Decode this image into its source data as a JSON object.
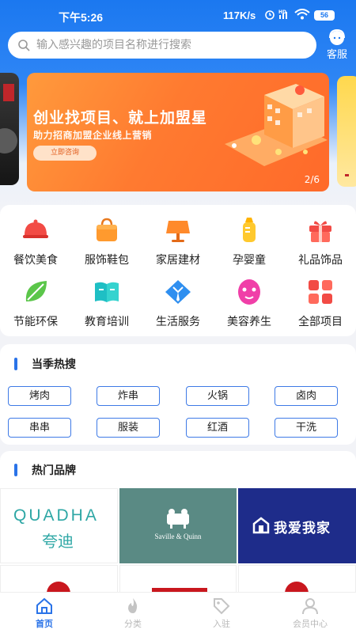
{
  "status": {
    "time": "下午5:26",
    "speed": "117K/s",
    "battery": "56"
  },
  "search": {
    "placeholder": "输入感兴趣的项目名称进行搜索",
    "service_label": "客服"
  },
  "banner": {
    "title": "创业找项目、就上加盟星",
    "subtitle": "助力招商加盟企业线上营销",
    "button": "立即咨询",
    "page": "2/6"
  },
  "categories": [
    {
      "label": "餐饮美食",
      "icon": "food-cloche-icon"
    },
    {
      "label": "服饰鞋包",
      "icon": "shopping-bag-icon"
    },
    {
      "label": "家居建材",
      "icon": "desk-lamp-icon"
    },
    {
      "label": "孕婴童",
      "icon": "baby-bottle-icon"
    },
    {
      "label": "礼品饰品",
      "icon": "gift-box-icon"
    },
    {
      "label": "节能环保",
      "icon": "leaf-icon"
    },
    {
      "label": "教育培训",
      "icon": "open-book-icon"
    },
    {
      "label": "生活服务",
      "icon": "suit-tie-icon"
    },
    {
      "label": "美容养生",
      "icon": "face-mask-icon"
    },
    {
      "label": "全部项目",
      "icon": "grid-icon"
    }
  ],
  "hot_search": {
    "title": "当季热搜",
    "tags": [
      "烤肉",
      "炸串",
      "火锅",
      "卤肉",
      "串串",
      "服装",
      "红酒",
      "干洗"
    ]
  },
  "brands": {
    "title": "热门品牌",
    "items": [
      {
        "name_en": "QUADHA",
        "name_cn": "夸迪"
      },
      {
        "name_en": "Saville & Quinn"
      },
      {
        "name_cn": "我爱我家"
      }
    ]
  },
  "tabbar": [
    {
      "label": "首页",
      "icon": "home-icon",
      "active": true
    },
    {
      "label": "分类",
      "icon": "flame-icon",
      "active": false
    },
    {
      "label": "入驻",
      "icon": "tag-icon",
      "active": false
    },
    {
      "label": "会员中心",
      "icon": "user-icon",
      "active": false
    }
  ],
  "colors": {
    "primary": "#2a73e8",
    "header": "#1b78f0",
    "banner": "#ff7a30",
    "brand_green": "#5a8a84",
    "brand_navy": "#1e2c8a"
  }
}
